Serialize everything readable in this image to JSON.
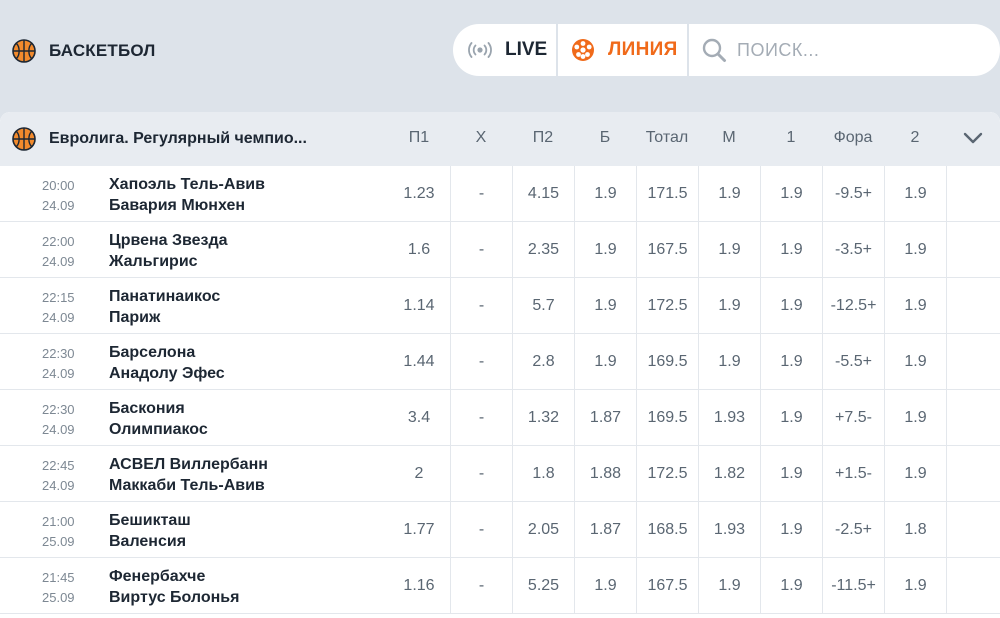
{
  "sport": {
    "title": "БАСКЕТБОЛ",
    "icon": "basketball-icon"
  },
  "modes": {
    "live_label": "LIVE",
    "line_label": "ЛИНИЯ",
    "search_placeholder": "ПОИСК...",
    "accent_color": "#f06a1a"
  },
  "league": {
    "name": "Евролига. Регулярный чемпио...",
    "columns": [
      "П1",
      "Х",
      "П2",
      "Б",
      "Тотал",
      "М",
      "1",
      "Фора",
      "2"
    ]
  },
  "matches": [
    {
      "time": "20:00",
      "date": "24.09",
      "home": "Хапоэль Тель-Авив",
      "away": "Бавария Мюнхен",
      "odds": [
        "1.23",
        "-",
        "4.15",
        "1.9",
        "171.5",
        "1.9",
        "1.9",
        "-9.5+",
        "1.9"
      ]
    },
    {
      "time": "22:00",
      "date": "24.09",
      "home": "Црвена Звезда",
      "away": "Жальгирис",
      "odds": [
        "1.6",
        "-",
        "2.35",
        "1.9",
        "167.5",
        "1.9",
        "1.9",
        "-3.5+",
        "1.9"
      ]
    },
    {
      "time": "22:15",
      "date": "24.09",
      "home": "Панатинаикос",
      "away": "Париж",
      "odds": [
        "1.14",
        "-",
        "5.7",
        "1.9",
        "172.5",
        "1.9",
        "1.9",
        "-12.5+",
        "1.9"
      ]
    },
    {
      "time": "22:30",
      "date": "24.09",
      "home": "Барселона",
      "away": "Анадолу Эфес",
      "odds": [
        "1.44",
        "-",
        "2.8",
        "1.9",
        "169.5",
        "1.9",
        "1.9",
        "-5.5+",
        "1.9"
      ]
    },
    {
      "time": "22:30",
      "date": "24.09",
      "home": "Баскония",
      "away": "Олимпиакос",
      "odds": [
        "3.4",
        "-",
        "1.32",
        "1.87",
        "169.5",
        "1.93",
        "1.9",
        "+7.5-",
        "1.9"
      ]
    },
    {
      "time": "22:45",
      "date": "24.09",
      "home": "АСВЕЛ Виллербанн",
      "away": "Маккаби Тель-Авив",
      "odds": [
        "2",
        "-",
        "1.8",
        "1.88",
        "172.5",
        "1.82",
        "1.9",
        "+1.5-",
        "1.9"
      ]
    },
    {
      "time": "21:00",
      "date": "25.09",
      "home": "Бешикташ",
      "away": "Валенсия",
      "odds": [
        "1.77",
        "-",
        "2.05",
        "1.87",
        "168.5",
        "1.93",
        "1.9",
        "-2.5+",
        "1.8"
      ]
    },
    {
      "time": "21:45",
      "date": "25.09",
      "home": "Фенербахче",
      "away": "Виртус Болонья",
      "odds": [
        "1.16",
        "-",
        "5.25",
        "1.9",
        "167.5",
        "1.9",
        "1.9",
        "-11.5+",
        "1.9"
      ]
    }
  ]
}
